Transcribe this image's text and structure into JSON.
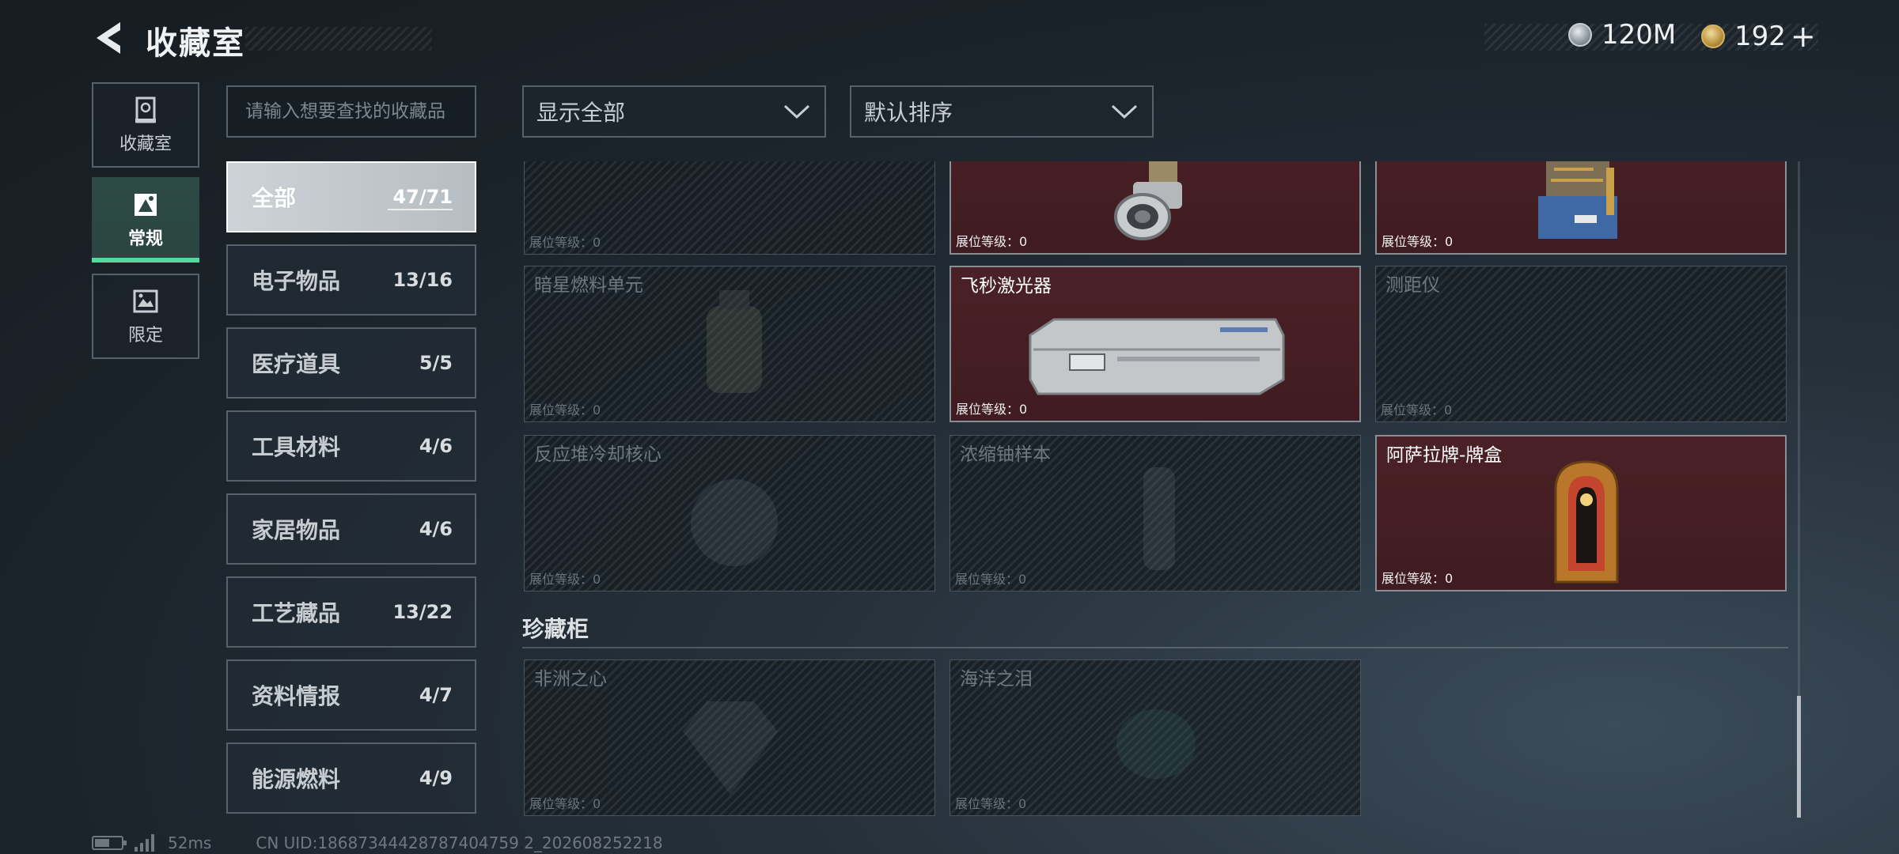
{
  "header": {
    "title": "收藏室",
    "currencies": [
      {
        "icon": "silver-coin-icon",
        "value": "120M"
      },
      {
        "icon": "gold-coin-icon",
        "value": "192"
      }
    ],
    "add_symbol": "+"
  },
  "nav": {
    "tabs": [
      {
        "label": "收藏室",
        "icon": "vault-icon",
        "active": false
      },
      {
        "label": "常规",
        "icon": "regular-icon",
        "active": true
      },
      {
        "label": "限定",
        "icon": "limited-icon",
        "active": false
      }
    ]
  },
  "search": {
    "placeholder": "请输入想要查找的收藏品"
  },
  "categories": [
    {
      "name": "全部",
      "count": "47/71",
      "active": true
    },
    {
      "name": "电子物品",
      "count": "13/16"
    },
    {
      "name": "医疗道具",
      "count": "5/5"
    },
    {
      "name": "工具材料",
      "count": "4/6"
    },
    {
      "name": "家居物品",
      "count": "4/6"
    },
    {
      "name": "工艺藏品",
      "count": "13/22"
    },
    {
      "name": "资料情报",
      "count": "4/7"
    },
    {
      "name": "能源燃料",
      "count": "4/9"
    }
  ],
  "filters": {
    "display": "显示全部",
    "sort": "默认排序"
  },
  "grid": {
    "level_text": "展位等级：0",
    "rows": [
      [
        {
          "name": "",
          "owned": false
        },
        {
          "name": "",
          "owned": true
        },
        {
          "name": "",
          "owned": true
        }
      ],
      [
        {
          "name": "暗星燃料单元",
          "owned": false
        },
        {
          "name": "飞秒激光器",
          "owned": true
        },
        {
          "name": "测距仪",
          "owned": false
        }
      ],
      [
        {
          "name": "反应堆冷却核心",
          "owned": false
        },
        {
          "name": "浓缩铀样本",
          "owned": false
        },
        {
          "name": "阿萨拉牌-牌盒",
          "owned": true
        }
      ]
    ]
  },
  "treasure": {
    "title": "珍藏柜",
    "items": [
      {
        "name": "非洲之心",
        "owned": false
      },
      {
        "name": "海洋之泪",
        "owned": false
      }
    ]
  },
  "footer": {
    "ping": "52ms",
    "uid": "CN UID:18687344428787404759 2_202608252218"
  }
}
